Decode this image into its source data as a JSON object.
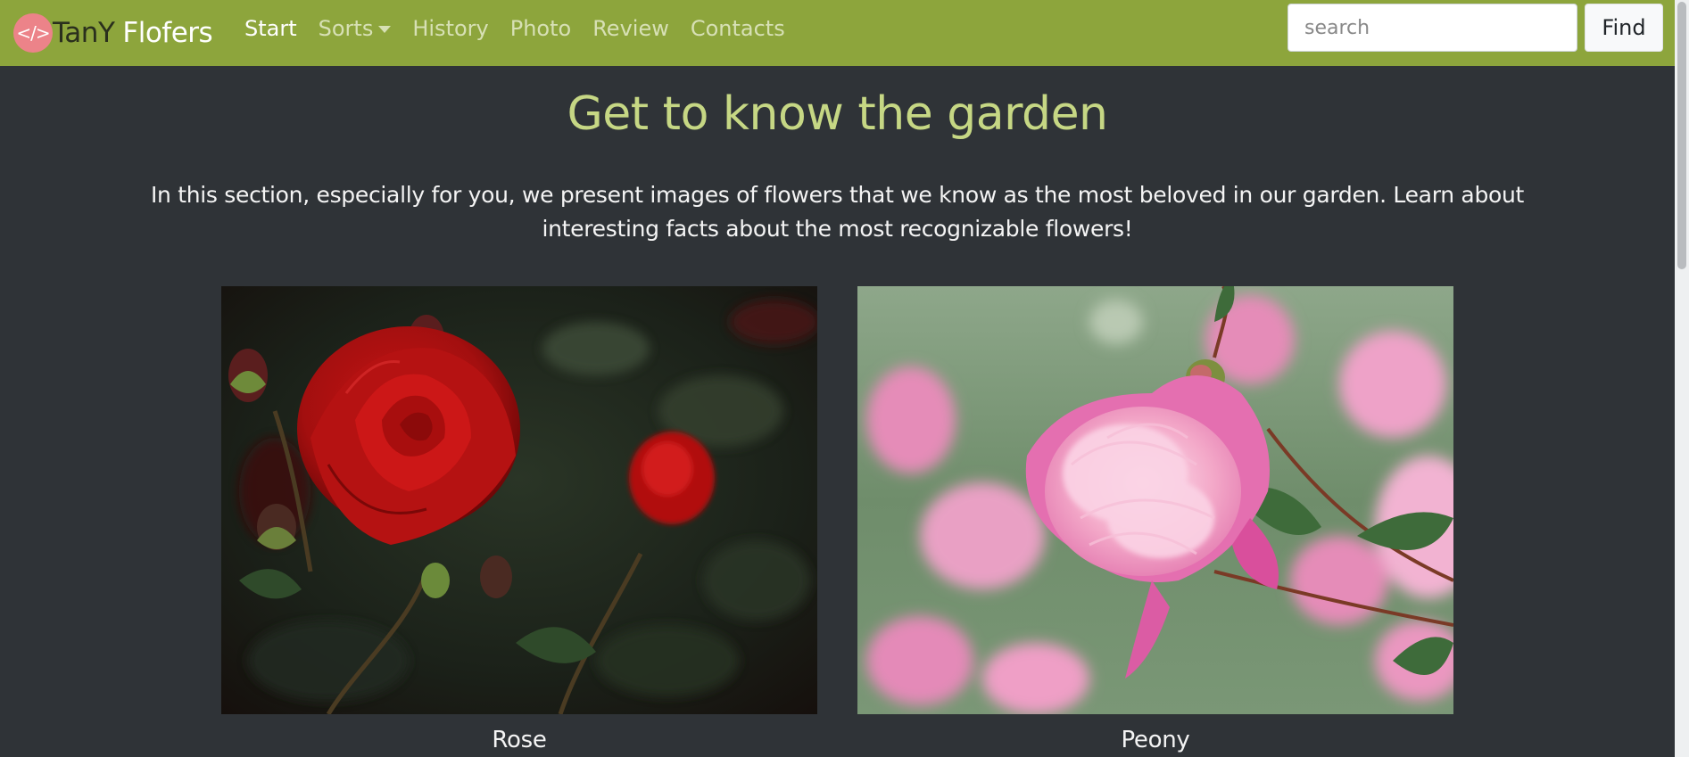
{
  "brand": {
    "logo_text": "</>",
    "name_part1": "TanY",
    "name_part2": "Flofers",
    "logo_color": "#ec8389"
  },
  "nav": {
    "items": [
      {
        "label": "Start",
        "active": true
      },
      {
        "label": "Sorts",
        "dropdown": true
      },
      {
        "label": "History"
      },
      {
        "label": "Photo"
      },
      {
        "label": "Review"
      },
      {
        "label": "Contacts"
      }
    ]
  },
  "search": {
    "placeholder": "search",
    "button_label": "Find"
  },
  "hero": {
    "title": "Get to know the garden",
    "text": "In this section, especially for you, we present images of flowers that we know as the most beloved in our garden. Learn about interesting facts about the most recognizable flowers!"
  },
  "gallery": {
    "items": [
      {
        "caption": "Rose",
        "image": "red-rose-photo"
      },
      {
        "caption": "Peony",
        "image": "pink-peony-photo"
      }
    ]
  },
  "colors": {
    "navbar": "#8da53c",
    "background": "#2f3337",
    "title": "#c6d784",
    "text": "#f4f4f4"
  }
}
